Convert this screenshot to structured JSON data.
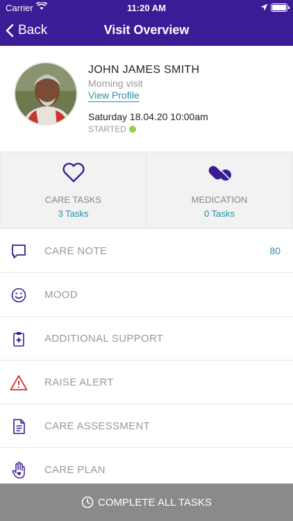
{
  "status_bar": {
    "carrier": "Carrier",
    "time": "11:20 AM"
  },
  "nav": {
    "back_label": "Back",
    "title": "Visit Overview"
  },
  "patient": {
    "name": "JOHN JAMES SMITH",
    "visit_type": "Morning visit",
    "view_profile": "View Profile",
    "date": "Saturday 18.04.20 10:00am",
    "status": "STARTED"
  },
  "tiles": [
    {
      "title": "CARE TASKS",
      "count": "3 Tasks",
      "icon": "heart-icon"
    },
    {
      "title": "MEDICATION",
      "count": "0 Tasks",
      "icon": "pills-icon"
    }
  ],
  "menu": [
    {
      "label": "CARE NOTE",
      "count": "80",
      "icon": "speech-bubble-icon"
    },
    {
      "label": "MOOD",
      "count": "",
      "icon": "smiley-icon"
    },
    {
      "label": "ADDITIONAL SUPPORT",
      "count": "",
      "icon": "medical-clipboard-icon"
    },
    {
      "label": "RAISE ALERT",
      "count": "",
      "icon": "warning-icon"
    },
    {
      "label": "CARE ASSESSMENT",
      "count": "",
      "icon": "document-icon"
    },
    {
      "label": "CARE PLAN",
      "count": "",
      "icon": "hand-icon"
    }
  ],
  "footer": {
    "button_label": "COMPLETE ALL TASKS",
    "icon": "clock-icon"
  },
  "colors": {
    "brand": "#3a1c96",
    "accent": "#2a8fa3",
    "alert": "#d32f2f",
    "status_started": "#8fd14f"
  }
}
